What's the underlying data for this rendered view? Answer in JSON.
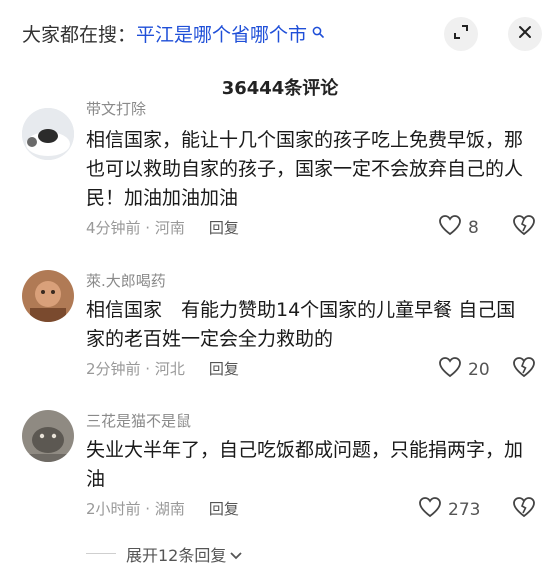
{
  "header": {
    "search_prefix": "大家都在搜：",
    "search_query": "平江是哪个省哪个市",
    "search_icon": "search-icon",
    "expand_icon": "expand-icon",
    "close_icon": "close-icon"
  },
  "comment_count": "36444条评论",
  "comments": [
    {
      "username": "带文打除",
      "text": "相信国家，能让十几个国家的孩子吃上免费早饭，那也可以救助自家的孩子，国家一定不会放弃自己的人民！加油加油加油",
      "meta": "4分钟前 · 河南",
      "reply": "回复",
      "likes": "8"
    },
    {
      "username": "萊.大郎喝药",
      "text": "相信国家　有能力赞助14个国家的儿童早餐 自己国家的老百姓一定会全力救助的",
      "meta": "2分钟前 · 河北",
      "reply": "回复",
      "likes": "20"
    },
    {
      "username": "三花是猫不是鼠",
      "text": "失业大半年了，自己吃饭都成问题，只能捐两字，加油",
      "meta": "2小时前 · 湖南",
      "reply": "回复",
      "likes": "273"
    }
  ],
  "expand_replies": "展开12条回复"
}
